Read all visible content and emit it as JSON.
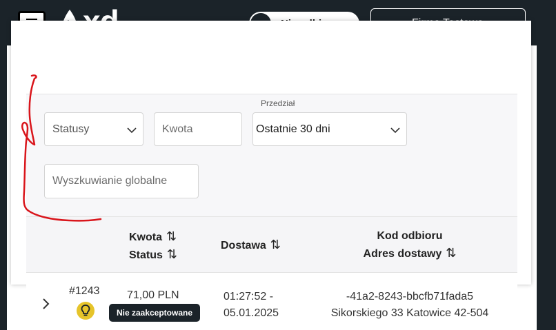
{
  "header": {
    "logo_text": "xd",
    "toggle_label": "Nie odbieram",
    "company_label": "Firma Testowa"
  },
  "filters": {
    "range_label": "Przedział",
    "status_placeholder": "Statusy",
    "amount_placeholder": "Kwota",
    "range_value": "Ostatnie 30 dni",
    "global_search_placeholder": "Wyszkuwianie globalne"
  },
  "table": {
    "columns": {
      "amount": "Kwota",
      "status": "Status",
      "delivery": "Dostawa",
      "pickup_code": "Kod odbioru",
      "delivery_address": "Adres dostawy"
    },
    "rows": [
      {
        "id": "#1243",
        "amount": "71,00 PLN",
        "status": "Nie zaakceptowane",
        "delivery_time": "01:27:52 -",
        "delivery_date": "05.01.2025",
        "pickup_code": "-41a2-8243-bbcfb71fada5",
        "address": "Sikorskiego 33 Katowice 42-504"
      }
    ]
  },
  "colors": {
    "header_bg": "#1b2329",
    "status_bulb": "#e6c42a",
    "annotation": "#d9151b"
  },
  "icons": {
    "menu": "hamburger-icon",
    "logo": "drop-icon",
    "dropdown": "chevron-down-icon",
    "sort": "sort-arrows-icon",
    "expand": "chevron-right-icon",
    "status": "lightbulb-icon"
  }
}
